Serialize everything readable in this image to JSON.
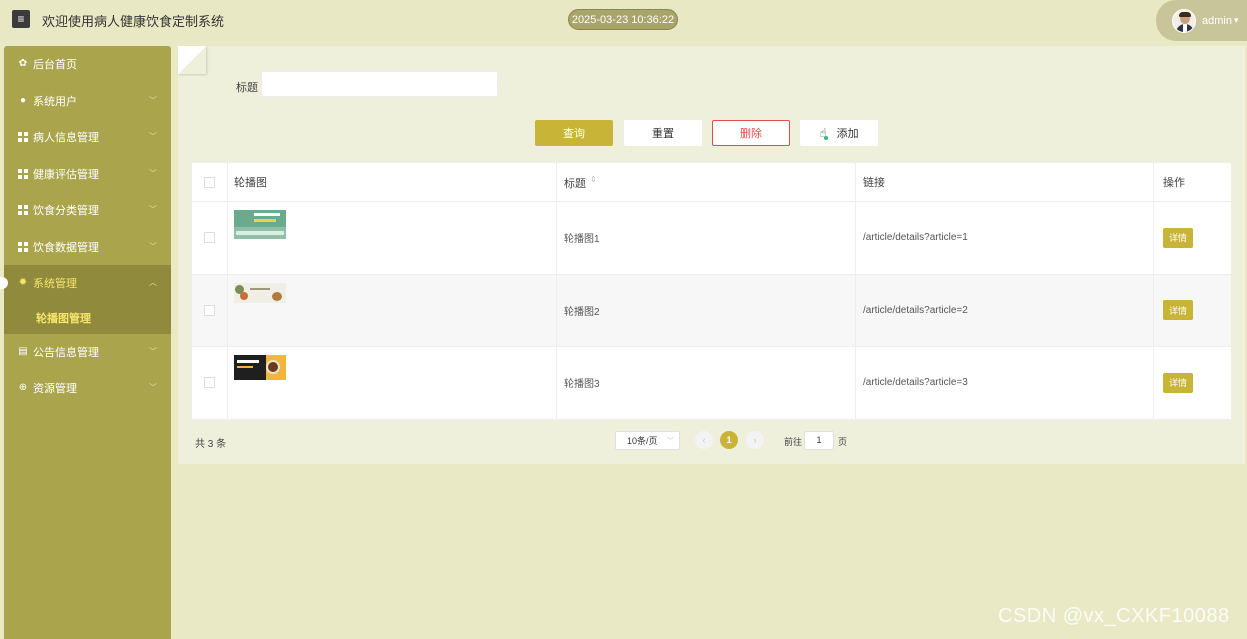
{
  "header": {
    "title": "欢迎使用病人健康饮食定制系统",
    "datetime": "2025-03-23 10:36:22",
    "user": "admin"
  },
  "sidebar": {
    "items": [
      {
        "label": "后台首页",
        "icon": "home-icon"
      },
      {
        "label": "系统用户",
        "icon": "user-icon"
      },
      {
        "label": "病人信息管理",
        "icon": "grid-icon"
      },
      {
        "label": "健康评估管理",
        "icon": "grid-icon"
      },
      {
        "label": "饮食分类管理",
        "icon": "grid-icon"
      },
      {
        "label": "饮食数据管理",
        "icon": "grid-icon"
      },
      {
        "label": "系统管理",
        "icon": "gear-icon"
      },
      {
        "label": "公告信息管理",
        "icon": "document-icon"
      },
      {
        "label": "资源管理",
        "icon": "plus-circle-icon"
      }
    ],
    "sub_item": "轮播图管理"
  },
  "search": {
    "label": "标题",
    "value": ""
  },
  "toolbar": {
    "query": "查询",
    "reset": "重置",
    "delete": "删除",
    "add": "添加"
  },
  "table": {
    "headers": [
      "轮播图",
      "标题",
      "链接",
      "操作"
    ],
    "rows": [
      {
        "title": "轮播图1",
        "link": "/article/details?article=1",
        "action": "详情"
      },
      {
        "title": "轮播图2",
        "link": "/article/details?article=2",
        "action": "详情"
      },
      {
        "title": "轮播图3",
        "link": "/article/details?article=3",
        "action": "详情"
      }
    ]
  },
  "pagination": {
    "total": "共 3 条",
    "page_size": "10条/页",
    "current_page": "1",
    "goto_label": "前往",
    "goto_value": "1",
    "goto_unit": "页"
  },
  "colors": {
    "accent": "#c8b437",
    "sidebar": "#aaa54c",
    "danger": "#e34b4b"
  },
  "watermark": "CSDN @vx_CXKF10088"
}
